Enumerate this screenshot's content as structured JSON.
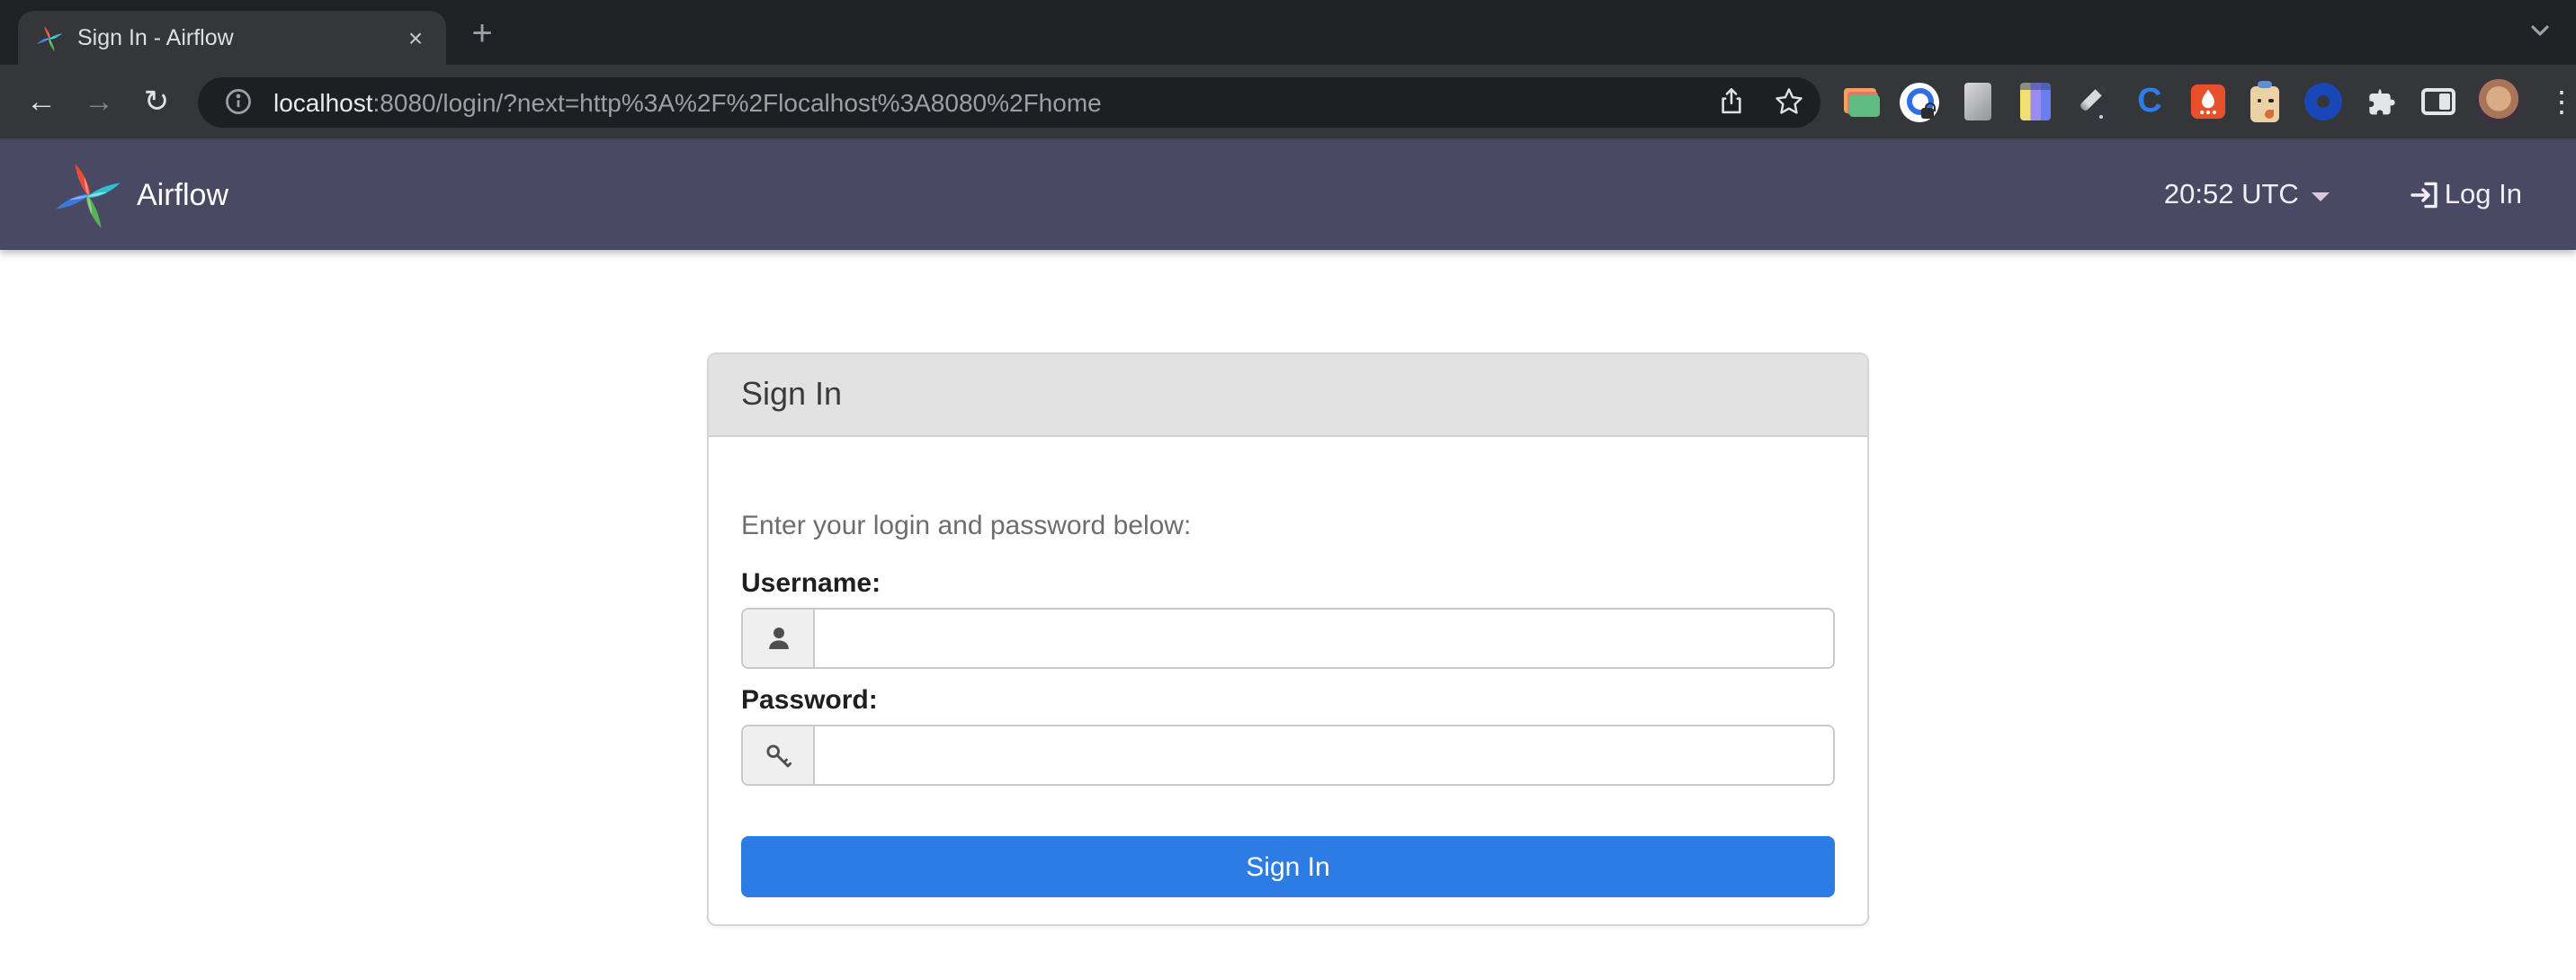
{
  "browser": {
    "tab_title": "Sign In - Airflow",
    "glyphs": {
      "close": "×",
      "new_tab": "+",
      "back": "←",
      "forward": "→",
      "reload": "↻",
      "kebab": "⋮"
    },
    "url": {
      "host": "localhost",
      "rest": ":8080/login/?next=http%3A%2F%2Flocalhost%3A8080%2Fhome",
      "full": "localhost:8080/login/?next=http%3A%2F%2Flocalhost%3A8080%2Fhome"
    },
    "extensions": [
      "folder",
      "password-manager",
      "notes-card",
      "spreadsheet",
      "pen-tool",
      "c-logo",
      "flame",
      "pet",
      "blue-ring",
      "puzzle",
      "side-panel"
    ]
  },
  "navbar": {
    "brand": "Airflow",
    "clock": "20:52 UTC",
    "login_label": "Log In"
  },
  "login": {
    "title": "Sign In",
    "intro": "Enter your login and password below:",
    "username_label": "Username:",
    "password_label": "Password:",
    "username_value": "",
    "password_value": "",
    "submit_label": "Sign In"
  },
  "colors": {
    "navbar_bg": "#4a4964",
    "button_blue": "#2d7be4",
    "card_header_bg": "#e2e2e2",
    "chrome_frame": "#202124",
    "chrome_toolbar": "#35363a",
    "omnibox_bg": "#1e1f22"
  }
}
